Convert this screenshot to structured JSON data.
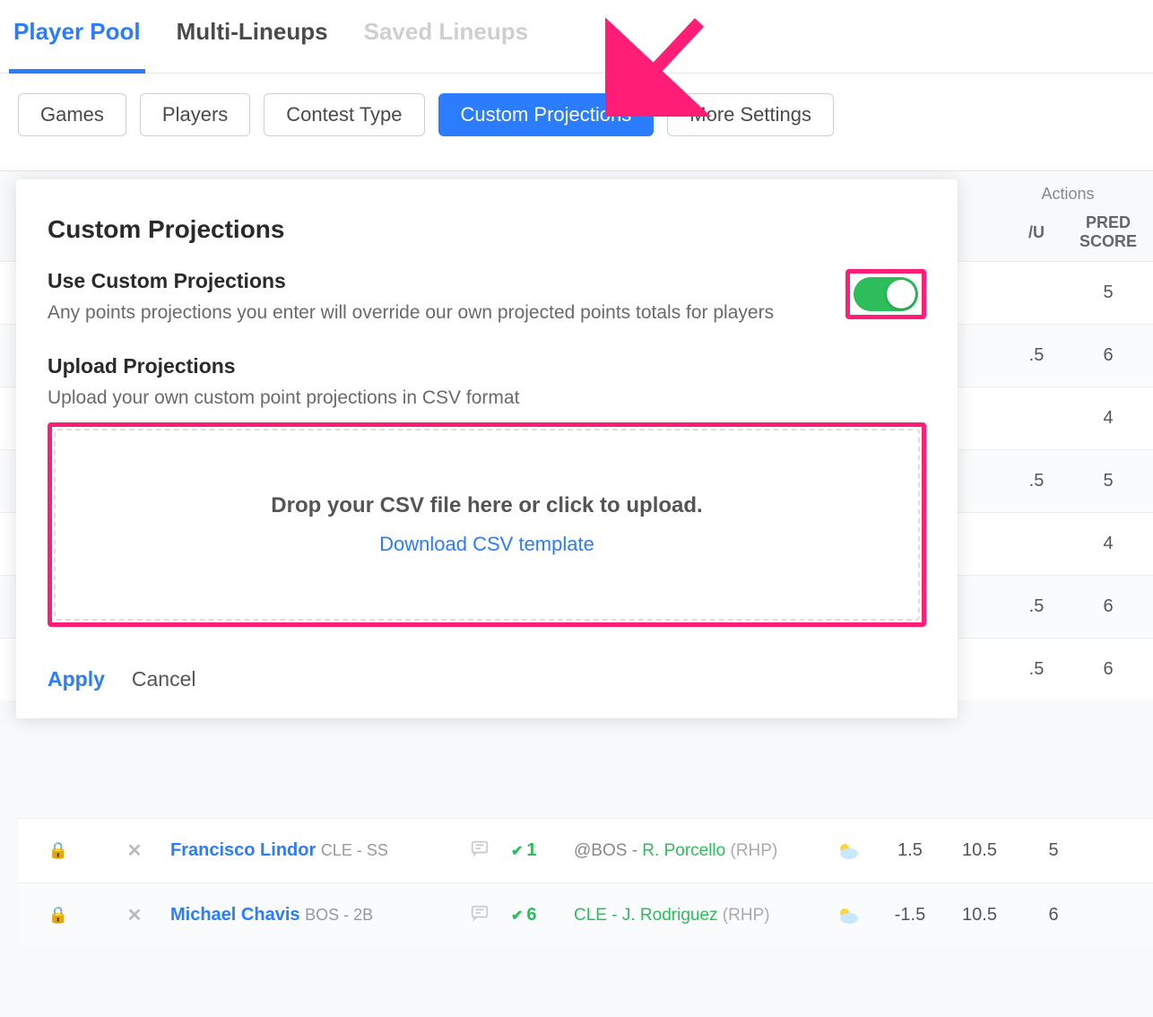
{
  "tabs": {
    "player_pool": "Player Pool",
    "multi_lineups": "Multi-Lineups",
    "saved_lineups": "Saved Lineups"
  },
  "filters": {
    "games": "Games",
    "players": "Players",
    "contest_type": "Contest Type",
    "custom_projections": "Custom Projections",
    "more_settings": "More Settings"
  },
  "panel": {
    "title": "Custom Projections",
    "use_title": "Use Custom Projections",
    "use_desc": "Any points projections you enter will override our own projected points totals for players",
    "upload_title": "Upload Projections",
    "upload_desc": "Upload your own custom point projections in CSV format",
    "drop_text": "Drop your CSV file here or click to upload.",
    "download_link": "Download CSV template",
    "apply": "Apply",
    "cancel": "Cancel"
  },
  "table": {
    "actions_header": "Actions",
    "ou_header": "/U",
    "pred_header": "PRED SCORE",
    "bg_rows": [
      {
        "ou": "",
        "pred": "5"
      },
      {
        "ou": ".5",
        "pred": "6"
      },
      {
        "ou": "",
        "pred": "4"
      },
      {
        "ou": ".5",
        "pred": "5"
      },
      {
        "ou": "",
        "pred": "4"
      },
      {
        "ou": ".5",
        "pred": "6"
      },
      {
        "ou": ".5",
        "pred": "6"
      }
    ]
  },
  "rows": [
    {
      "player": "Francisco Lindor",
      "team": "CLE - SS",
      "check": "1",
      "matchup_prefix": "@BOS - ",
      "matchup_opp": "R. Porcello",
      "matchup_paren": " (RHP)",
      "num1": "1.5",
      "num2": "10.5",
      "num3": "5"
    },
    {
      "player": "Michael Chavis",
      "team": "BOS - 2B",
      "check": "6",
      "matchup_prefix": "CLE - ",
      "matchup_opp": "J. Rodriguez",
      "matchup_paren": " (RHP)",
      "num1": "-1.5",
      "num2": "10.5",
      "num3": "6"
    }
  ]
}
